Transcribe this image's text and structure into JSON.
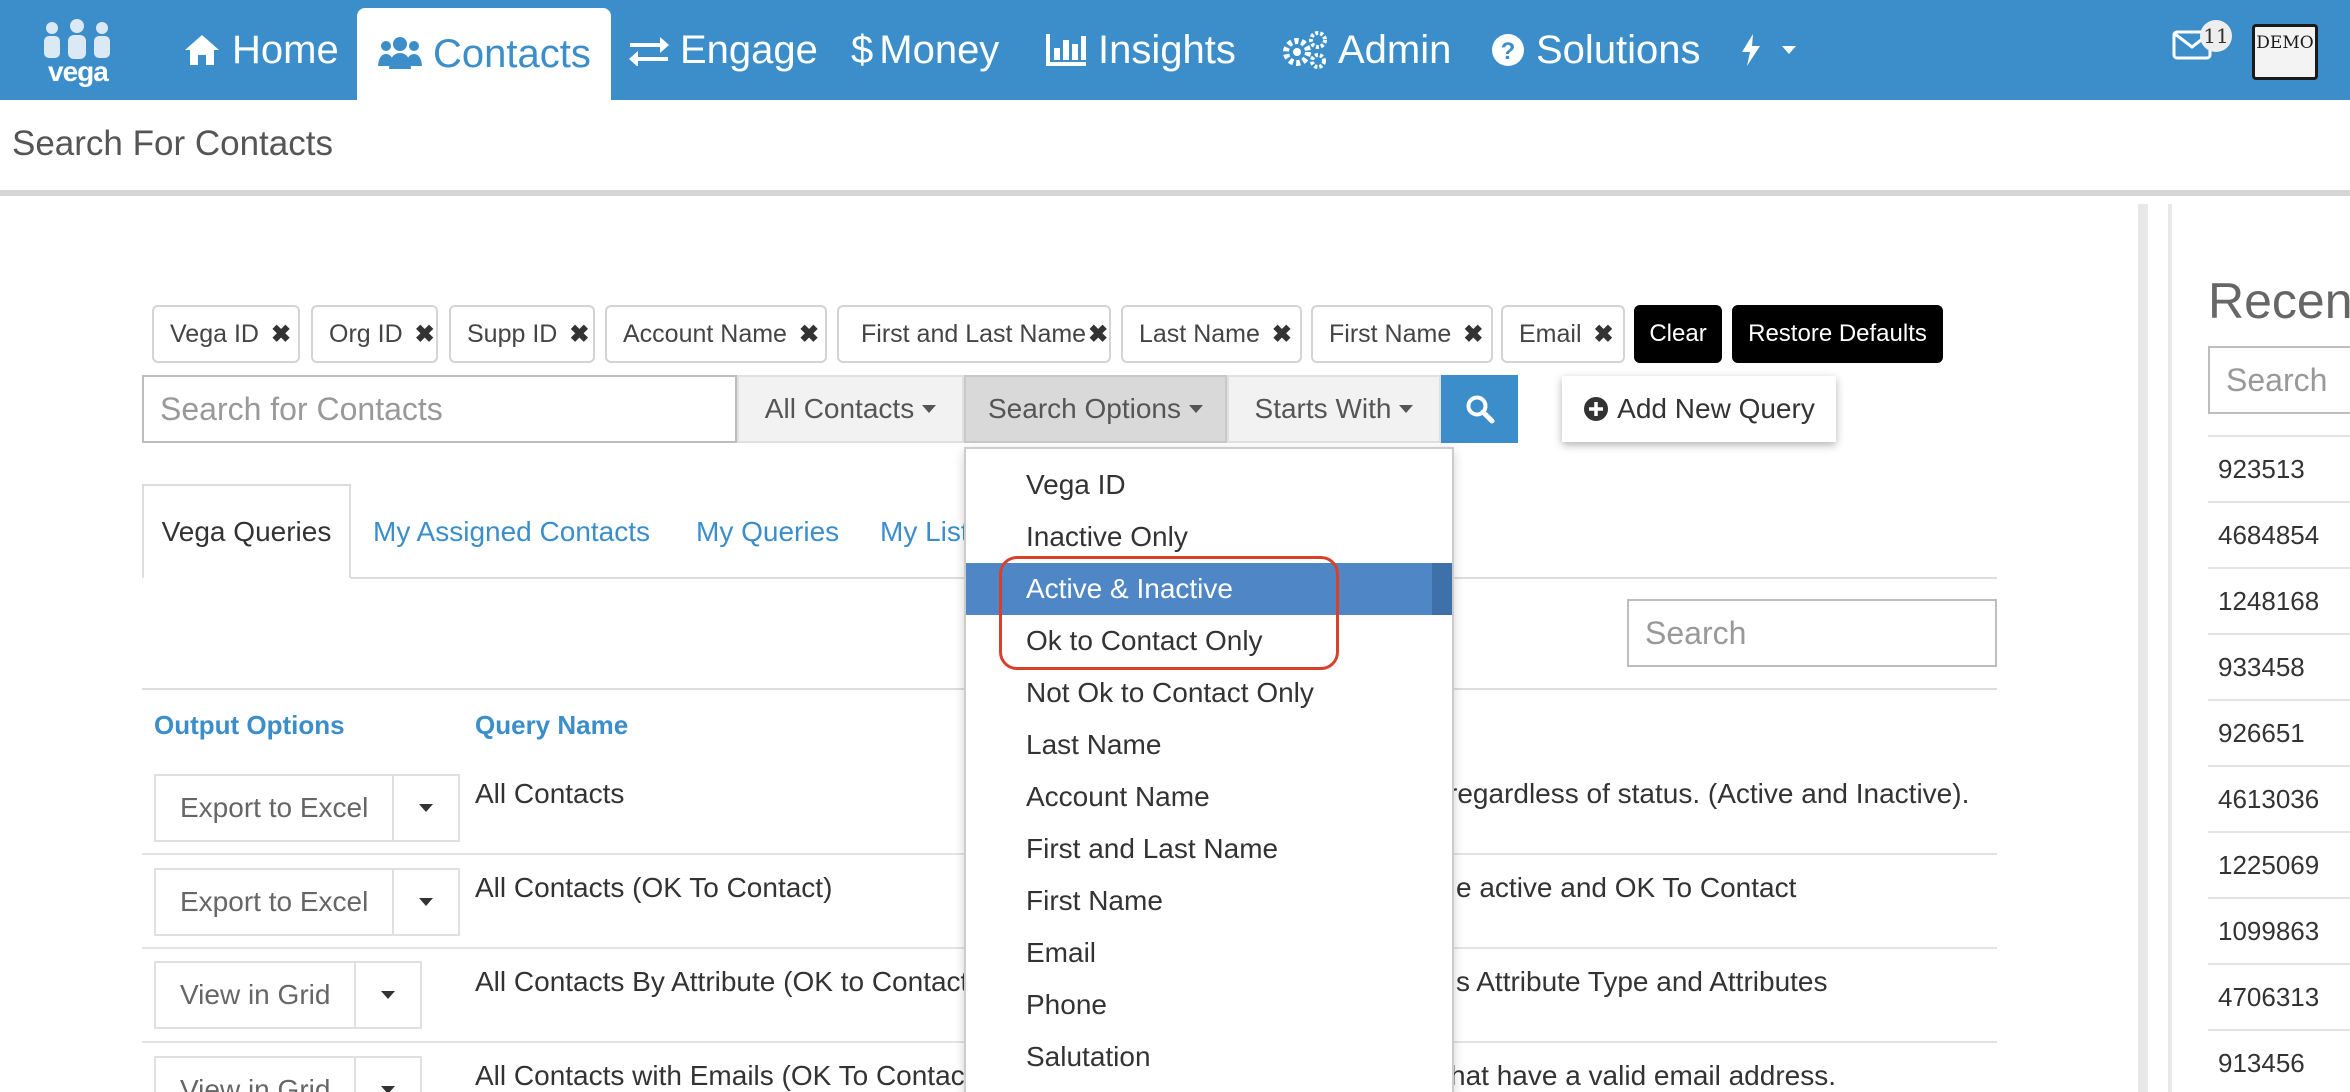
{
  "nav": {
    "logo_text": "vega",
    "items": [
      {
        "label": "Home",
        "icon": "home-icon"
      },
      {
        "label": "Contacts",
        "icon": "users-icon"
      },
      {
        "label": "Engage",
        "icon": "exchange-icon"
      },
      {
        "label": "Money",
        "icon": "dollar-icon"
      },
      {
        "label": "Insights",
        "icon": "bar-chart-icon"
      },
      {
        "label": "Admin",
        "icon": "gears-icon"
      },
      {
        "label": "Solutions",
        "icon": "question-circle-icon"
      }
    ],
    "active": "Contacts",
    "mail_count": "11",
    "demo_label": "DEMO"
  },
  "page": {
    "title": "Search For Contacts"
  },
  "chips": [
    "Vega ID",
    "Org ID",
    "Supp ID",
    "Account Name",
    "First and Last Name",
    "Last Name",
    "First Name",
    "Email"
  ],
  "chip_remove_glyph": "✖",
  "actions": {
    "clear": "Clear",
    "restore": "Restore Defaults"
  },
  "search": {
    "placeholder": "Search for Contacts",
    "scope": "All Contacts",
    "options": "Search Options",
    "match": "Starts With",
    "add_query": "Add New Query"
  },
  "tabs": [
    "Vega Queries",
    "My Assigned Contacts",
    "My Queries",
    "My Lists"
  ],
  "active_tab": "Vega Queries",
  "grid": {
    "search_placeholder": "Search",
    "headers": {
      "output": "Output Options",
      "query": "Query Name"
    },
    "rows": [
      {
        "output": "Export to Excel",
        "name": "All Contacts",
        "desc": "regardless of status. (Active and Inactive)."
      },
      {
        "output": "Export to Excel",
        "name": "All Contacts (OK To Contact)",
        "desc": "e active and OK To Contact"
      },
      {
        "output": "View in Grid",
        "name": "All Contacts By Attribute (OK to Contact",
        "desc": "s Attribute Type and Attributes"
      },
      {
        "output": "View in Grid",
        "name": "All Contacts with Emails (OK To Contact",
        "desc": "hat have a valid email address."
      }
    ]
  },
  "dropdown": {
    "items": [
      "Vega ID",
      "Inactive Only",
      "Active & Inactive",
      "Ok to Contact Only",
      "Not Ok to Contact Only",
      "Last Name",
      "Account Name",
      "First and Last Name",
      "First Name",
      "Email",
      "Phone",
      "Salutation"
    ],
    "selected": "Active & Inactive",
    "highlight_color": "#d9402a"
  },
  "recent": {
    "title": "Recent",
    "search_placeholder": "Search",
    "ids": [
      "923513",
      "4684854",
      "1248168",
      "933458",
      "926651",
      "4613036",
      "1225069",
      "1099863",
      "4706313",
      "913456"
    ]
  },
  "colors": {
    "brand": "#3b8ec9",
    "selected": "#4f86c6"
  }
}
